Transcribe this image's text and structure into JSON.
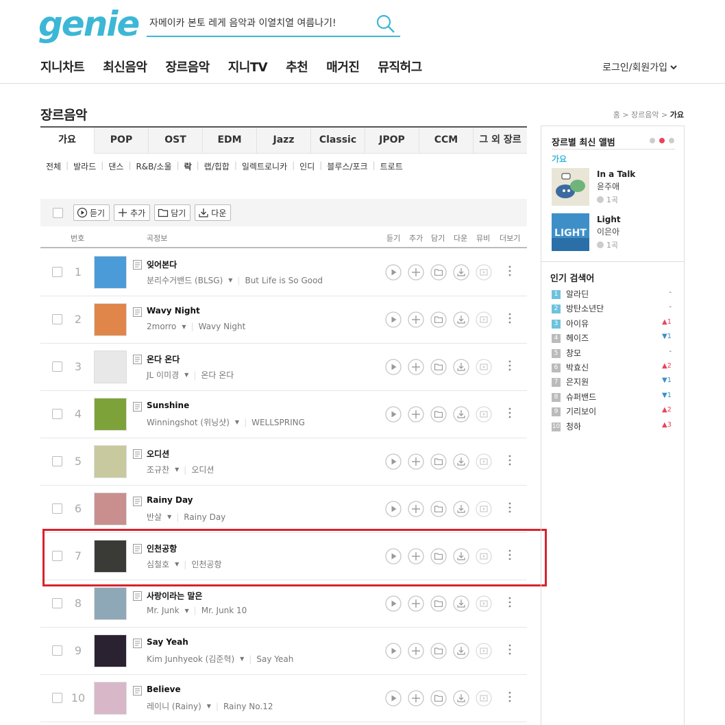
{
  "header": {
    "logo": "genie",
    "search_value": "자메이카 본토 레게 음악과 이열치열 여름나기!",
    "nav": [
      "지니차트",
      "최신음악",
      "장르음악",
      "지니TV",
      "추천",
      "매거진",
      "뮤직허그"
    ],
    "login": "로그인/회원가입"
  },
  "page": {
    "title": "장르음악",
    "breadcrumb": {
      "home": "홈",
      "sep": ">",
      "level1": "장르음악",
      "current": "가요"
    }
  },
  "tabs": [
    "가요",
    "POP",
    "OST",
    "EDM",
    "Jazz",
    "Classic",
    "JPOP",
    "CCM",
    "그 외 장르"
  ],
  "subgenres": [
    "전체",
    "발라드",
    "댄스",
    "R&B/소울",
    "락",
    "랩/힙합",
    "일렉트로니카",
    "인디",
    "블루스/포크",
    "트로트"
  ],
  "toolbar": {
    "play": "듣기",
    "add": "추가",
    "save": "담기",
    "download": "다운"
  },
  "columns": {
    "num": "번호",
    "info": "곡정보",
    "play": "듣기",
    "add": "추가",
    "save": "담기",
    "down": "다운",
    "mv": "뮤비",
    "more": "더보기"
  },
  "songs": [
    {
      "rank": "1",
      "title": "잊어본다",
      "artist": "분리수거밴드 (BLSG)",
      "album": "But Life is So Good",
      "art_bg": "#4a9bd8"
    },
    {
      "rank": "2",
      "title": "Wavy Night",
      "artist": "2morro",
      "album": "Wavy Night",
      "art_bg": "#e0864a"
    },
    {
      "rank": "3",
      "title": "온다 온다",
      "artist": "JL 이미경",
      "album": "온다 온다",
      "art_bg": "#e8e8e8"
    },
    {
      "rank": "4",
      "title": "Sunshine",
      "artist": "Winningshot (위닝샷)",
      "album": "WELLSPRING",
      "art_bg": "#7da23a"
    },
    {
      "rank": "5",
      "title": "오디션",
      "artist": "조규찬",
      "album": "오디션",
      "art_bg": "#c9c9a0"
    },
    {
      "rank": "6",
      "title": "Rainy Day",
      "artist": "반살",
      "album": "Rainy Day",
      "art_bg": "#c98f8f"
    },
    {
      "rank": "7",
      "title": "인천공항",
      "artist": "심철호",
      "album": "인천공항",
      "art_bg": "#3a3a36"
    },
    {
      "rank": "8",
      "title": "사랑이라는 말은",
      "artist": "Mr. Junk",
      "album": "Mr. Junk 10",
      "art_bg": "#8fa8b8"
    },
    {
      "rank": "9",
      "title": "Say Yeah",
      "artist": "Kim Junhyeok (김준혁)",
      "album": "Say Yeah",
      "art_bg": "#2a2230"
    },
    {
      "rank": "10",
      "title": "Believe",
      "artist": "레이니 (Rainy)",
      "album": "Rainy No.12",
      "art_bg": "#d8b8c8"
    }
  ],
  "sidebar": {
    "heading": "장르별 최신 앨범",
    "genre": "가요",
    "albums": [
      {
        "title": "In a Talk",
        "artist": "윤주애",
        "count": "1곡"
      },
      {
        "title": "Light",
        "artist": "이은아",
        "count": "1곡"
      }
    ],
    "light_art_text": "LIGHT",
    "popular_heading": "인기 검색어",
    "popular": [
      {
        "rank": "1",
        "keyword": "알라딘",
        "change": "-",
        "dir": "same"
      },
      {
        "rank": "2",
        "keyword": "방탄소년단",
        "change": "-",
        "dir": "same"
      },
      {
        "rank": "3",
        "keyword": "아이유",
        "change": "▲1",
        "dir": "up"
      },
      {
        "rank": "4",
        "keyword": "헤이즈",
        "change": "▼1",
        "dir": "down"
      },
      {
        "rank": "5",
        "keyword": "창모",
        "change": "-",
        "dir": "same"
      },
      {
        "rank": "6",
        "keyword": "박효신",
        "change": "▲2",
        "dir": "up"
      },
      {
        "rank": "7",
        "keyword": "은지원",
        "change": "▼1",
        "dir": "down"
      },
      {
        "rank": "8",
        "keyword": "슈퍼밴드",
        "change": "▼1",
        "dir": "down"
      },
      {
        "rank": "9",
        "keyword": "기리보이",
        "change": "▲2",
        "dir": "up"
      },
      {
        "rank": "10",
        "keyword": "청하",
        "change": "▲3",
        "dir": "up"
      }
    ]
  },
  "colors": {
    "brand": "#3cb7d6",
    "highlight": "#d9212c",
    "up": "#e8445a",
    "down": "#3a8fc8"
  }
}
